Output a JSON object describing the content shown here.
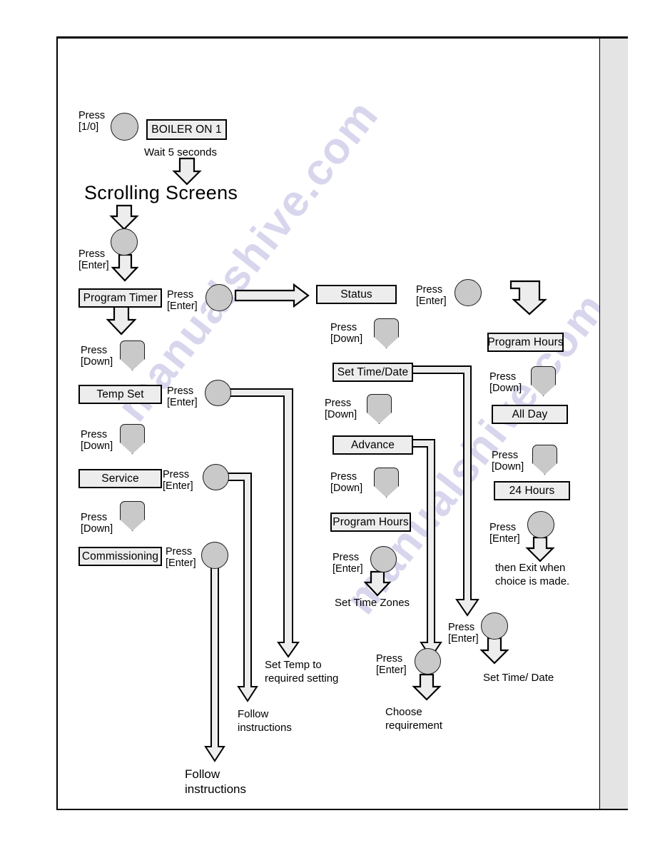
{
  "diagram": {
    "title": "Scrolling Screens",
    "colors": {
      "box_fill": "#ededed",
      "button_fill": "#c9c9c9",
      "arrow_fill": "#ededed",
      "outline": "#000000",
      "side_strip": "#e4e4e4",
      "watermark": "#b9b6e0"
    },
    "boxes": [
      {
        "id": "boiler_on",
        "label": "BOILER ON  1"
      },
      {
        "id": "program_timer",
        "label": "Program Timer"
      },
      {
        "id": "temp_set",
        "label": "Temp Set"
      },
      {
        "id": "service",
        "label": "Service"
      },
      {
        "id": "commissioning",
        "label": "Commissioning"
      },
      {
        "id": "status",
        "label": "Status"
      },
      {
        "id": "set_time_date",
        "label": "Set Time/Date"
      },
      {
        "id": "advance",
        "label": "Advance"
      },
      {
        "id": "program_hours_mid",
        "label": "Program Hours"
      },
      {
        "id": "program_hours_rt",
        "label": "Program Hours"
      },
      {
        "id": "all_day",
        "label": "All Day"
      },
      {
        "id": "24_hours",
        "label": "24 Hours"
      }
    ],
    "press_labels": {
      "power": "Press\n[1/0]",
      "enter_scroll": "Press\n[Enter]",
      "enter_timer": "Press\n[Enter]",
      "down_timer": "Press\n[Down]",
      "enter_temp": "Press\n[Enter]",
      "down_temp": "Press\n[Down]",
      "enter_service": "Press\n[Enter]",
      "down_service": "Press\n[Down]",
      "enter_comm": "Press\n[Enter]",
      "enter_status": "Press\n[Enter]",
      "down_status": "Press\n[Down]",
      "down_settime": "Press\n[Down]",
      "down_advance": "Press\n[Down]",
      "enter_proghrs": "Press\n[Enter]",
      "down_proghrs_rt": "Press\n[Down]",
      "down_allday": "Press\n[Down]",
      "enter_24hrs": "Press\n[Enter]",
      "enter_advance": "Press\n[Enter]",
      "enter_bottom_rt": "Press\n[Enter]"
    },
    "notes": {
      "wait": "Wait 5 seconds",
      "then_exit": "then Exit when\nchoice is made.",
      "set_time_zones": "Set Time Zones",
      "set_temp": "Set Temp to\nrequired setting",
      "follow_service": "Follow\ninstructions",
      "follow_comm": "Follow\ninstructions",
      "choose_req": "Choose\nrequirement",
      "set_time_date_bottom": "Set Time/ Date"
    },
    "watermarks": [
      "manualshive.com",
      "manualshive.com"
    ]
  }
}
